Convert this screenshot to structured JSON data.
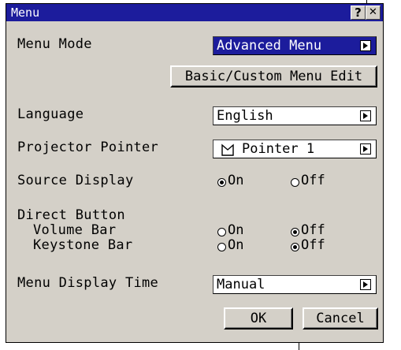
{
  "window": {
    "title": "Menu",
    "help_glyph": "?",
    "close_glyph": "✕"
  },
  "rows": {
    "menu_mode": {
      "label": "Menu Mode",
      "value": "Advanced Menu"
    },
    "custom_edit": {
      "button": "Basic/Custom Menu Edit"
    },
    "language": {
      "label": "Language",
      "value": "English"
    },
    "pointer": {
      "label": "Projector Pointer",
      "value": "Pointer 1"
    },
    "source_display": {
      "label": "Source Display",
      "on": "On",
      "off": "Off",
      "selected": "On"
    },
    "direct_button": {
      "label": "Direct Button",
      "volume_bar": {
        "label": "Volume Bar",
        "on": "On",
        "off": "Off",
        "selected": "Off"
      },
      "keystone_bar": {
        "label": "Keystone Bar",
        "on": "On",
        "off": "Off",
        "selected": "Off"
      }
    },
    "display_time": {
      "label": "Menu Display Time",
      "value": "Manual"
    }
  },
  "footer": {
    "ok": "OK",
    "cancel": "Cancel"
  },
  "colors": {
    "titlebar": "#1c1c9c",
    "dialog_bg": "#d4d0c8",
    "highlight": "#1c1c9c"
  }
}
